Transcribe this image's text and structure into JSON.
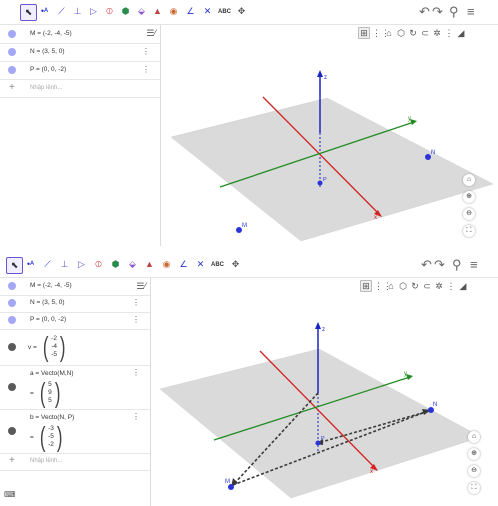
{
  "toolbar": {
    "text_tool_label": "ABC",
    "undo_icon": "undo-icon",
    "redo_icon": "redo-icon",
    "search_icon": "search-icon",
    "menu_icon": "hamburger-menu-icon"
  },
  "panel1": {
    "rows": [
      {
        "label": "M = (-2, -4, -5)"
      },
      {
        "label": "N = (3, 5, 0)"
      },
      {
        "label": "P = (0, 0, -2)"
      }
    ],
    "input_placeholder": "Nhập lệnh..."
  },
  "panel2": {
    "rows": [
      {
        "label": "M = (-2, -4, -5)"
      },
      {
        "label": "N = (3, 5, 0)"
      },
      {
        "label": "P = (0, 0, -2)"
      }
    ],
    "v": {
      "prefix": "v =",
      "comps": [
        "-2",
        "-4",
        "-5"
      ]
    },
    "a": {
      "def": "a = Vecto(M,N)",
      "prefix": "=",
      "comps": [
        "5",
        "9",
        "5"
      ]
    },
    "b": {
      "def": "b = Vecto(N, P)",
      "prefix": "=",
      "comps": [
        "-3",
        "-5",
        "-2"
      ]
    },
    "input_placeholder": "Nhập lệnh..."
  },
  "labels": {
    "M": "M",
    "N": "N",
    "P": "P",
    "z": "z",
    "x": "x",
    "y": "y"
  },
  "colors": {
    "x_axis": "#d22222",
    "y_axis": "#1f8c1f",
    "z_axis": "#1c24c2",
    "point": "#2b35d6",
    "vector": "#3a3a3a",
    "plane": "#bcbcbc",
    "accent": "#6557d2"
  }
}
